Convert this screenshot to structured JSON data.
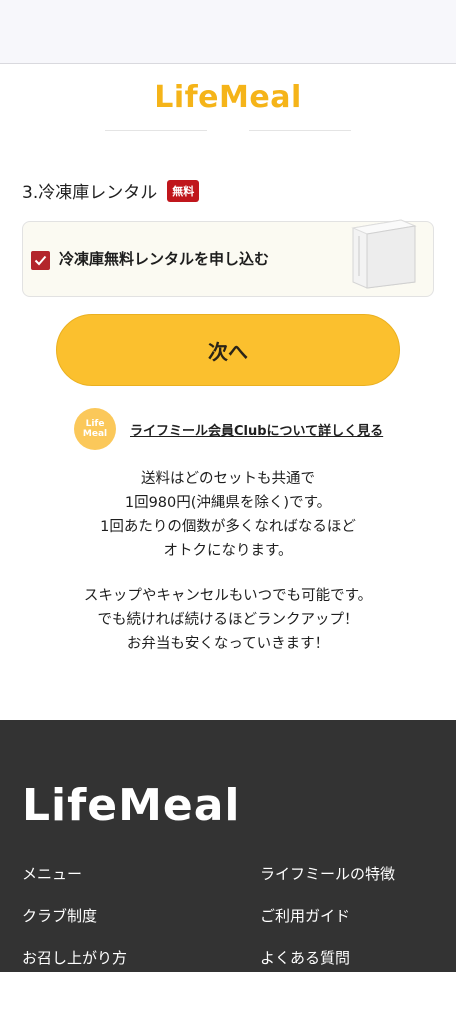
{
  "brand": {
    "logo_text": "LifeMeal",
    "accent_color": "#f5b419"
  },
  "section": {
    "title": "3.冷凍庫レンタル",
    "badge": "無料",
    "badge_color": "#c0161c"
  },
  "rental_option": {
    "label": "冷凍庫無料レンタルを申し込む",
    "checked": true,
    "image_icon": "freezer-icon"
  },
  "next_button": {
    "label": "次へ",
    "color": "#fbc02e"
  },
  "club": {
    "logo_line1": "Life",
    "logo_line2": "Meal",
    "link_text": "ライフミール会員Clubについて詳しく見る"
  },
  "info": {
    "paragraph1": [
      "送料はどのセットも共通で",
      "1回980円(沖縄県を除く)です。",
      "1回あたりの個数が多くなればなるほど",
      "オトクになります。"
    ],
    "paragraph2": [
      "スキップやキャンセルもいつでも可能です。",
      "でも続ければ続けるほどランクアップ！",
      "お弁当も安くなっていきます！"
    ]
  },
  "footer": {
    "logo_text": "LifeMeal",
    "background": "#333333",
    "links_left": [
      "メニュー",
      "クラブ制度",
      "お召し上がり方"
    ],
    "links_right": [
      "ライフミールの特徴",
      "ご利用ガイド",
      "よくある質問"
    ]
  }
}
